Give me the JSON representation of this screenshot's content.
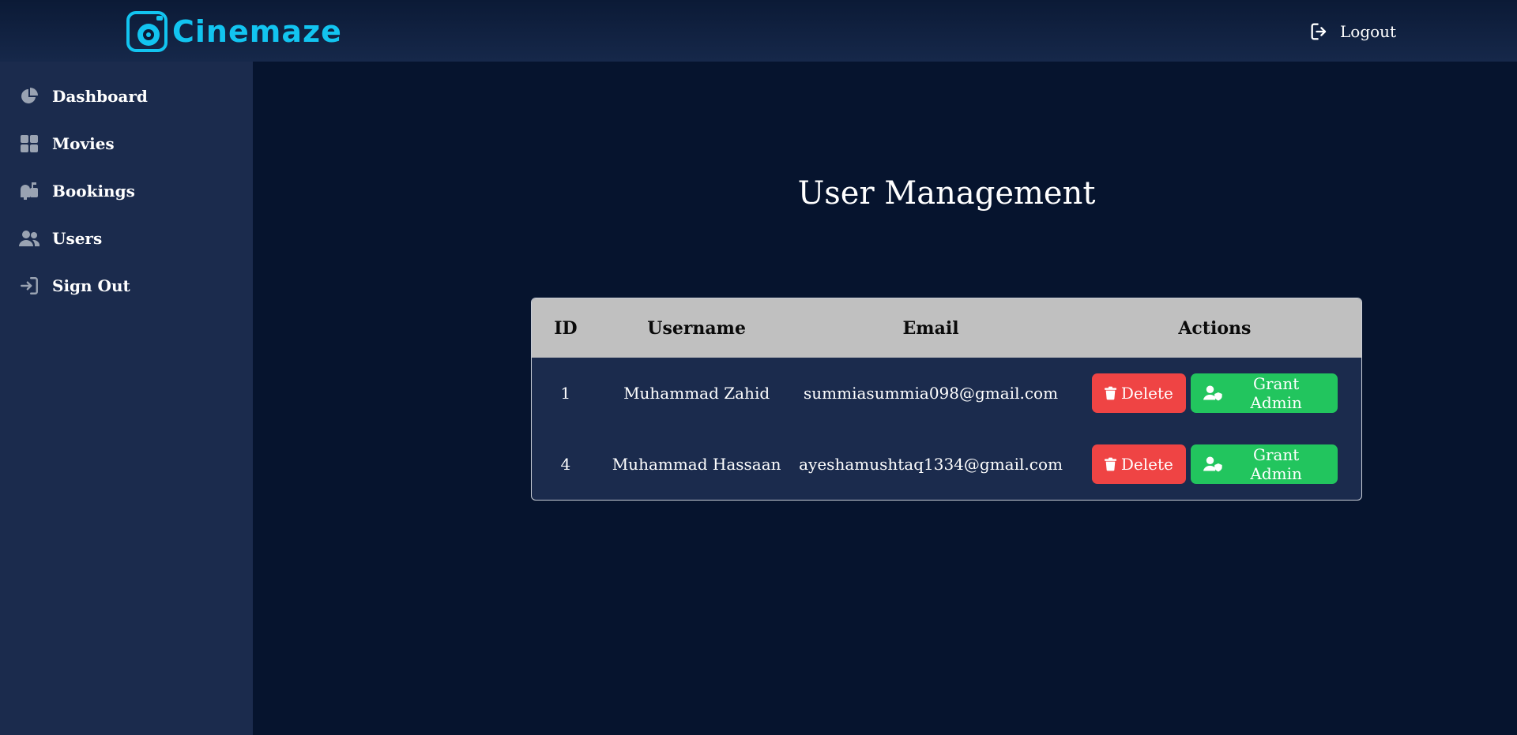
{
  "header": {
    "brand": "Cinemaze",
    "logout_label": "Logout",
    "brand_color": "#12c4f0"
  },
  "sidebar": {
    "items": [
      {
        "label": "Dashboard",
        "icon": "pie-chart-icon"
      },
      {
        "label": "Movies",
        "icon": "grid-icon"
      },
      {
        "label": "Bookings",
        "icon": "mailbox-icon"
      },
      {
        "label": "Users",
        "icon": "users-icon"
      },
      {
        "label": "Sign Out",
        "icon": "sign-in-icon"
      }
    ]
  },
  "main": {
    "title": "User Management",
    "table": {
      "headers": {
        "id": "ID",
        "username": "Username",
        "email": "Email",
        "actions": "Actions"
      },
      "rows": [
        {
          "id": "1",
          "username": "Muhammad Zahid",
          "email": "summiasummia098@gmail.com"
        },
        {
          "id": "4",
          "username": "Muhammad Hassaan",
          "email": "ayeshamushtaq1334@gmail.com"
        }
      ],
      "delete_label": "Delete",
      "grant_label": "Grant Admin"
    }
  },
  "colors": {
    "delete": "#ef4444",
    "grant": "#22c55e",
    "sidebar": "#1b2b4d",
    "background": "#06142e"
  }
}
